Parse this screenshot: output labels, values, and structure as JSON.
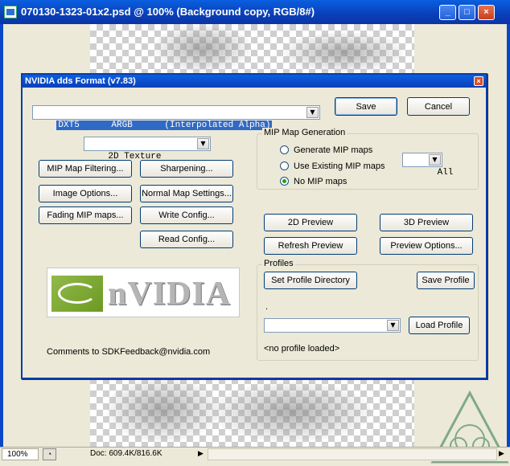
{
  "window": {
    "title": "070130-1323-01x2.psd @ 100% (Background copy, RGB/8#)",
    "minimize": "_",
    "maximize": "□",
    "close": "×"
  },
  "status": {
    "zoom": "100%",
    "doc": "Doc: 609.4K/816.6K",
    "arrow": "▶",
    "arrow_right": "▶"
  },
  "dialog": {
    "title": "NVIDIA dds Format (v7.83)",
    "close": "×",
    "format_select": "DXT5      ARGB      (Interpolated Alpha)",
    "save": "Save",
    "cancel": "Cancel",
    "texture_select": "2D Texture",
    "mip_filtering": "MIP Map Filtering...",
    "sharpening": "Sharpening...",
    "image_options": "Image Options...",
    "normal_map": "Normal Map Settings...",
    "fading_mip": "Fading MIP maps...",
    "write_config": "Write Config...",
    "read_config": "Read Config...",
    "mip_group": {
      "legend": "MIP Map Generation",
      "generate": "Generate MIP maps",
      "use_existing": "Use Existing MIP maps",
      "no_mip": "No MIP maps",
      "selected": "no_mip",
      "count_select": "All"
    },
    "preview_2d": "2D Preview",
    "preview_3d": "3D Preview",
    "refresh_preview": "Refresh Preview",
    "preview_options": "Preview Options...",
    "profiles": {
      "legend": "Profiles",
      "set_dir": "Set Profile Directory",
      "save": "Save Profile",
      "path": ".",
      "select": "",
      "load": "Load Profile",
      "status": "<no profile loaded>"
    },
    "logo_text": "nVIDIA",
    "comments": "Comments to SDKFeedback@nvidia.com"
  }
}
